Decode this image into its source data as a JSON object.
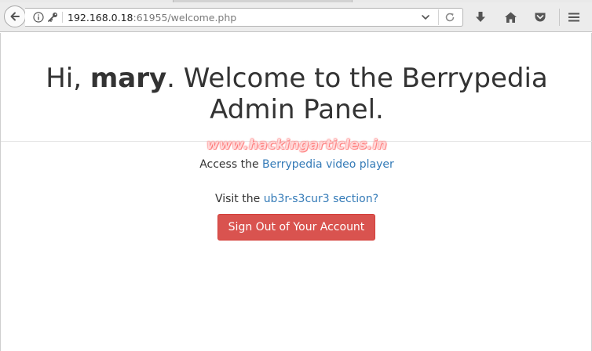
{
  "browser": {
    "url_host": "192.168.0.18",
    "url_rest": ":61955/welcome.php",
    "icons": [
      "back-arrow-icon",
      "info-icon",
      "key-icon",
      "chevron-down-icon",
      "reload-icon",
      "download-icon",
      "home-icon",
      "pocket-icon",
      "hamburger-menu-icon"
    ]
  },
  "page": {
    "greeting_prefix": "Hi, ",
    "username": "mary",
    "greeting_suffix": ". Welcome to the Berrypedia",
    "greeting_line2": "Admin Panel.",
    "watermark": "www.hackingarticles.in",
    "access_prefix": "Access the ",
    "access_link": "Berrypedia video player",
    "visit_prefix": "Visit the ",
    "visit_link": "ub3r-s3cur3 section?",
    "signout_label": "Sign Out of Your Account"
  },
  "colors": {
    "link": "#337ab7",
    "danger_button": "#d9534f",
    "text": "#333333"
  }
}
